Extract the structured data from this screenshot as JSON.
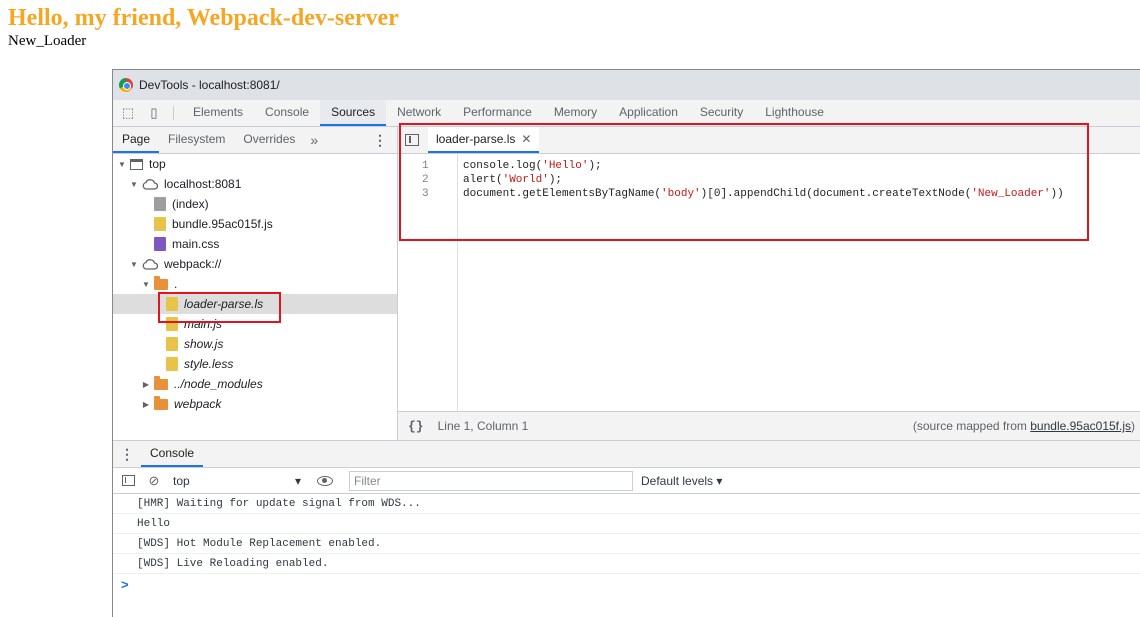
{
  "page": {
    "heading": "Hello, my friend, Webpack-dev-server",
    "body_text": "New_Loader"
  },
  "devtools": {
    "window_title": "DevTools - localhost:8081/",
    "main_tabs": [
      "Elements",
      "Console",
      "Sources",
      "Network",
      "Performance",
      "Memory",
      "Application",
      "Security",
      "Lighthouse"
    ],
    "active_main_tab": "Sources",
    "navigator": {
      "tabs": [
        "Page",
        "Filesystem",
        "Overrides"
      ],
      "more_glyph": "»",
      "tree": [
        {
          "label": "top",
          "level": 0,
          "icon": "frame-icon",
          "expanded": true
        },
        {
          "label": "localhost:8081",
          "level": 1,
          "icon": "cloud-icon",
          "expanded": true
        },
        {
          "label": "(index)",
          "level": 2,
          "icon": "file-icon-gray"
        },
        {
          "label": "bundle.95ac015f.js",
          "level": 2,
          "icon": "file-icon-yellow"
        },
        {
          "label": "main.css",
          "level": 2,
          "icon": "file-icon-purple"
        },
        {
          "label": "webpack://",
          "level": 1,
          "icon": "cloud-icon",
          "expanded": true
        },
        {
          "label": ".",
          "level": 2,
          "icon": "folder-icon",
          "expanded": true
        },
        {
          "label": "loader-parse.ls",
          "level": 3,
          "icon": "file-icon-yellow",
          "italic": true,
          "selected": true
        },
        {
          "label": "main.js",
          "level": 3,
          "icon": "file-icon-yellow",
          "italic": true
        },
        {
          "label": "show.js",
          "level": 3,
          "icon": "file-icon-yellow",
          "italic": true
        },
        {
          "label": "style.less",
          "level": 3,
          "icon": "file-icon-yellow",
          "italic": true
        },
        {
          "label": "../node_modules",
          "level": 2,
          "icon": "folder-icon",
          "expanded": false,
          "italic": true
        },
        {
          "label": "webpack",
          "level": 2,
          "icon": "folder-icon",
          "expanded": false,
          "italic": true
        }
      ]
    },
    "editor": {
      "open_file": "loader-parse.ls",
      "code_lines": [
        {
          "num": "1",
          "text": "console.log('Hello');"
        },
        {
          "num": "2",
          "text": "alert('World');"
        },
        {
          "num": "3",
          "text": "document.getElementsByTagName('body')[0].appendChild(document.createTextNode('New_Loader'))"
        }
      ],
      "cursor_position": "Line 1, Column 1",
      "source_mapped_prefix": "(source mapped from ",
      "source_mapped_file": "bundle.95ac015f.js",
      "source_mapped_suffix": ")"
    },
    "drawer": {
      "tab": "Console",
      "context": "top",
      "filter_placeholder": "Filter",
      "levels": "Default levels ▾",
      "messages": [
        "[HMR] Waiting for update signal from WDS...",
        "Hello",
        "[WDS] Hot Module Replacement enabled.",
        "[WDS] Live Reloading enabled."
      ],
      "prompt": ">"
    }
  },
  "colors": {
    "heading": "#f5a623",
    "highlight_box": "#e0141e",
    "accent": "#1a73e8",
    "file_yellow": "#e8c34a",
    "file_gray": "#9e9e9e",
    "file_purple": "#7e57c2",
    "folder_orange": "#e8913a",
    "string": "#c41a16"
  }
}
